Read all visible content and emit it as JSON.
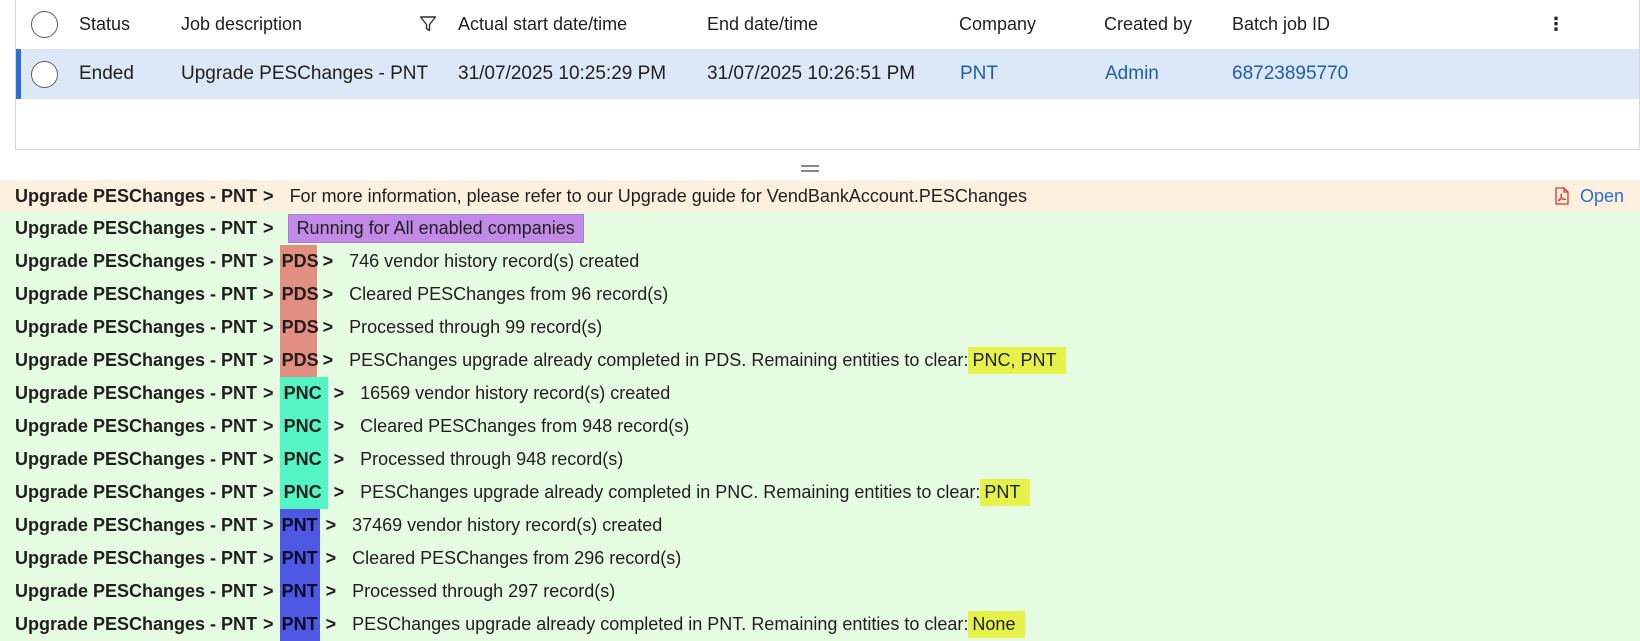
{
  "grid": {
    "columns": [
      "Status",
      "Job description",
      "Actual start date/time",
      "End date/time",
      "Company",
      "Created by",
      "Batch job ID"
    ],
    "row": {
      "status": "Ended",
      "job_description": "Upgrade PESChanges - PNT",
      "start": "31/07/2025 10:25:29 PM",
      "end": "31/07/2025 10:26:51 PM",
      "company": "PNT",
      "created_by": "Admin",
      "batch_job_id": "68723895770"
    }
  },
  "log": {
    "prefix": "Upgrade PESChanges - PNT",
    "sep": ">",
    "info_message": "For more information, please refer to our Upgrade guide for VendBankAccount.PESChanges",
    "open_label": "Open",
    "running_label": "Running for All enabled companies",
    "entries": [
      {
        "tag": "PDS",
        "message": "746 vendor history record(s) created",
        "highlight": ""
      },
      {
        "tag": "PDS",
        "message": "Cleared PESChanges from 96 record(s)",
        "highlight": ""
      },
      {
        "tag": "PDS",
        "message": "Processed through 99 record(s)",
        "highlight": ""
      },
      {
        "tag": "PDS",
        "message": "PESChanges upgrade already completed in PDS. Remaining entities to clear: ",
        "highlight": "PNC, PNT"
      },
      {
        "tag": "PNC",
        "message": "16569 vendor history record(s) created",
        "highlight": ""
      },
      {
        "tag": "PNC",
        "message": "Cleared PESChanges from 948 record(s)",
        "highlight": ""
      },
      {
        "tag": "PNC",
        "message": "Processed through 948 record(s)",
        "highlight": ""
      },
      {
        "tag": "PNC",
        "message": "PESChanges upgrade already completed in PNC. Remaining entities to clear: ",
        "highlight": "PNT"
      },
      {
        "tag": "PNT",
        "message": "37469 vendor history record(s) created",
        "highlight": ""
      },
      {
        "tag": "PNT",
        "message": "Cleared PESChanges from 296 record(s)",
        "highlight": ""
      },
      {
        "tag": "PNT",
        "message": "Processed through 297 record(s)",
        "highlight": ""
      },
      {
        "tag": "PNT",
        "message": "PESChanges upgrade already completed in PNT. Remaining entities to clear: ",
        "highlight": "None"
      }
    ]
  }
}
